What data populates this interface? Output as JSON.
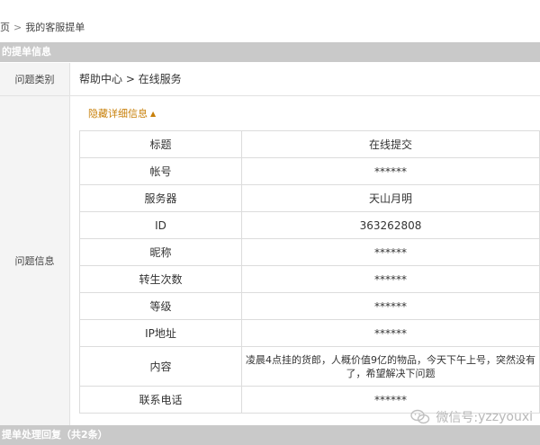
{
  "breadcrumb": {
    "parent": "页",
    "separator": ">",
    "current": "我的客服提单"
  },
  "section_title": "的提单信息",
  "question_type": {
    "label": "问题类别",
    "value": "帮助中心 > 在线服务"
  },
  "question_info": {
    "label": "问题信息",
    "toggle_label": "隐藏详细信息",
    "rows": [
      {
        "key": "标题",
        "value": "在线提交"
      },
      {
        "key": "帐号",
        "value": "******"
      },
      {
        "key": "服务器",
        "value": "天山月明"
      },
      {
        "key": "ID",
        "value": "363262808"
      },
      {
        "key": "昵称",
        "value": "******"
      },
      {
        "key": "转生次数",
        "value": "******"
      },
      {
        "key": "等级",
        "value": "******"
      },
      {
        "key": "IP地址",
        "value": "******"
      },
      {
        "key": "内容",
        "value": "凌晨4点挂的货郎，人概价值9亿的物品，今天下午上号，突然没有了，希望解决下问题"
      },
      {
        "key": "联系电话",
        "value": "******"
      }
    ]
  },
  "bottom_bar_text": "提单处理回复（共2条）",
  "watermark": {
    "prefix": "微信号:",
    "account": "yzzyouxi",
    "icon": "wechat-icon"
  }
}
